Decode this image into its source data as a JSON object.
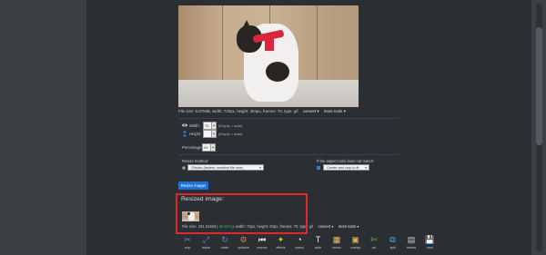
{
  "source": {
    "info": {
      "file_size_label": "File size: ",
      "file_size": "5.57MiB",
      "details": ", width: 720px, height: 404px, frames: 70, type: gif",
      "convert": "convert ▾",
      "more_tools": "more tools ▾"
    }
  },
  "form": {
    "width_label": "Width:",
    "width_value": "72",
    "width_hint": "(Empty = auto)",
    "height_label": "Height:",
    "height_value": "",
    "height_hint": "(Empty = auto)",
    "percentage_label": "Percentage:",
    "percentage_value": "20",
    "resize_method_label": "Resize method:",
    "resize_method_value": "Gifsicle (fastest, smallest file size)",
    "aspect_label": "If the aspect ratio does not match:",
    "aspect_value": "Center and crop to fit",
    "resize_button": "Resize image!"
  },
  "result": {
    "title": "Resized image:",
    "size_prefix": "File size: ",
    "size": "191.01KiB",
    "size_sep": " (",
    "percent": "-96.65%",
    "details": "), width: 72px, height: 40px, frames: 70, type: gif",
    "convert": "convert ▾",
    "more_tools": "more tools ▾"
  },
  "tools": [
    {
      "label": "crop",
      "icon": "crop-icon",
      "color": "#5b8fd6"
    },
    {
      "label": "resize",
      "icon": "resize-icon",
      "color": "#5b8fd6"
    },
    {
      "label": "rotate",
      "icon": "rotate-icon",
      "color": "#5b8fd6"
    },
    {
      "label": "optimize",
      "icon": "optimize-icon",
      "color": "#c98a3a"
    },
    {
      "label": "reverse",
      "icon": "reverse-icon",
      "color": "#ffffff"
    },
    {
      "label": "effects",
      "icon": "effects-icon",
      "color": "#d8c23a"
    },
    {
      "label": "speed",
      "icon": "speed-icon",
      "color": "#ffffff"
    },
    {
      "label": "write",
      "icon": "write-icon",
      "color": "#f2f2f2"
    },
    {
      "label": "censor",
      "icon": "censor-icon",
      "color": "#e9c46a"
    },
    {
      "label": "overlay",
      "icon": "overlay-icon",
      "color": "#e4b34a"
    },
    {
      "label": "cut",
      "icon": "cut-icon",
      "color": "#6cc04a"
    },
    {
      "label": "split",
      "icon": "split-icon",
      "color": "#4ab0e0"
    },
    {
      "label": "frames",
      "icon": "frames-icon",
      "color": "#d0d0d0"
    },
    {
      "label": "save",
      "icon": "save-icon",
      "color": "#e6e6e6"
    }
  ]
}
